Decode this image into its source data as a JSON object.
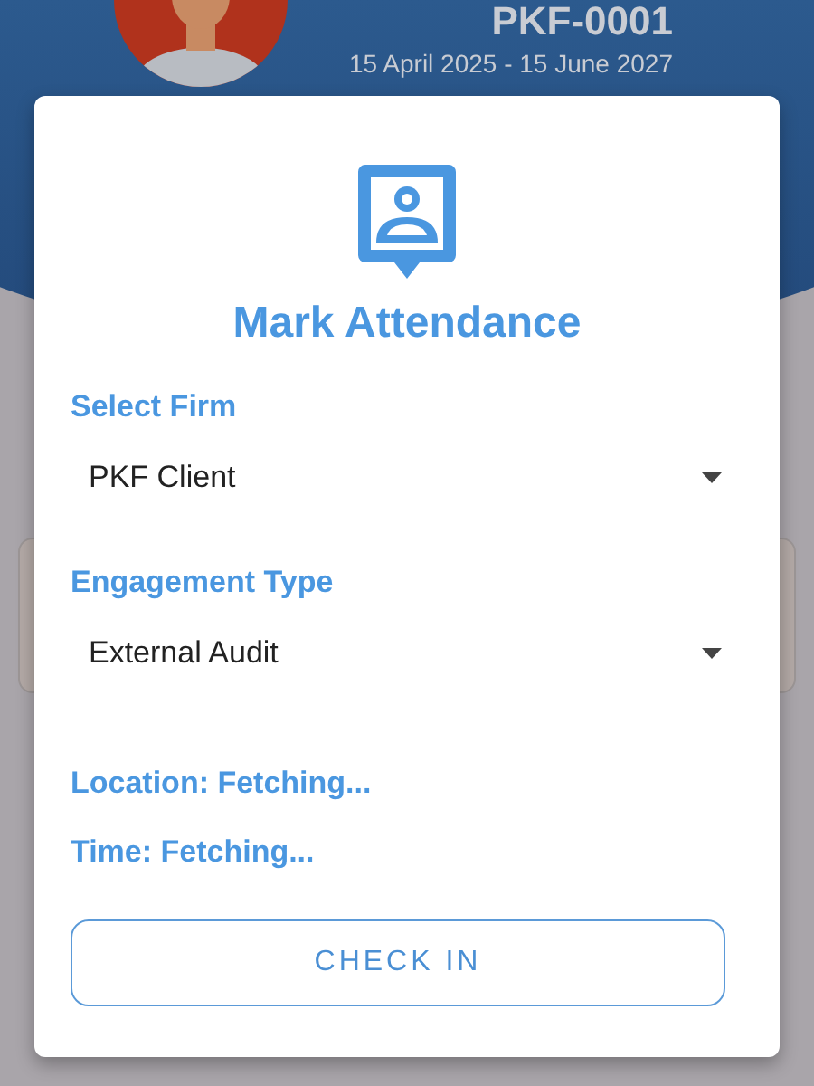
{
  "header": {
    "title": "PKF-0001",
    "subtitle": "15 April 2025 - 15 June 2027"
  },
  "dialog": {
    "title": "Mark Attendance",
    "fields": [
      {
        "label": "Select Firm",
        "value": "PKF Client"
      },
      {
        "label": "Engagement Type",
        "value": "External Audit"
      }
    ],
    "status_lines": [
      "Location: Fetching...",
      "Time: Fetching..."
    ],
    "button": "CHECK IN"
  }
}
